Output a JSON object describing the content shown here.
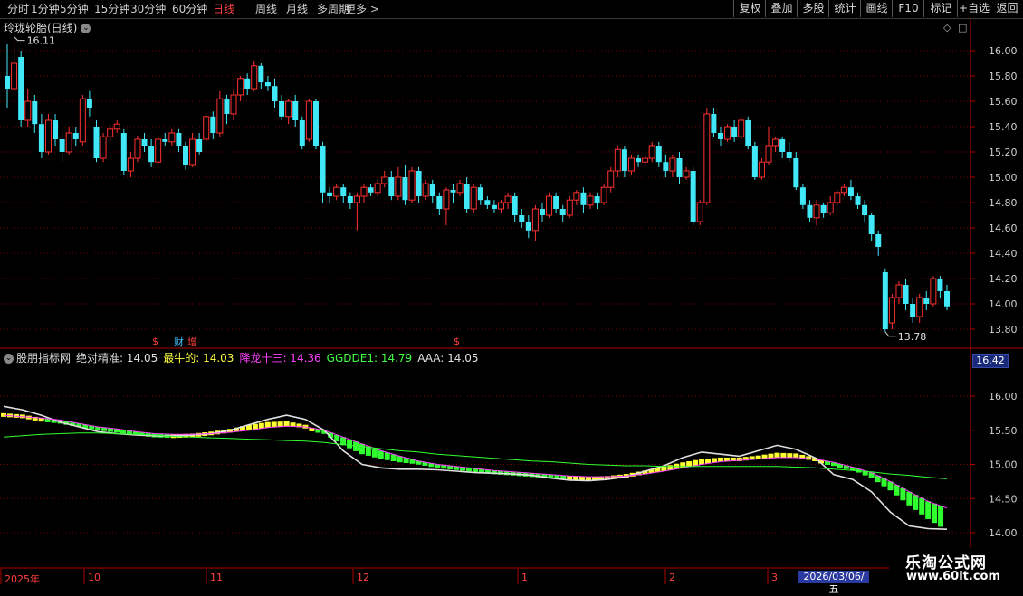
{
  "toolbar": {
    "periods": [
      "分时",
      "1分钟",
      "5分钟",
      "15分钟",
      "30分钟",
      "60分钟",
      "日线",
      "周线",
      "月线",
      "多周期",
      "更多 >"
    ],
    "active_period": "日线",
    "right_buttons": [
      "复权",
      "叠加",
      "多股",
      "统计",
      "画线",
      "F10",
      "标记",
      "+自选",
      "返回"
    ]
  },
  "chart_title": "玲珑轮胎(日线)",
  "price_high_label": "16.11",
  "price_low_label": "13.78",
  "markers": {
    "s1": "$",
    "cai": "财",
    "zeng": "增",
    "s2": "$"
  },
  "indicator": {
    "name": "股朋指标网",
    "items": [
      {
        "label": "绝对精准: 14.05",
        "color": "#e0e0e0"
      },
      {
        "label": "最牛的: 14.03",
        "color": "#ffff40"
      },
      {
        "label": "降龙十三: 14.36",
        "color": "#ff40ff"
      },
      {
        "label": "GGDDE1: 14.79",
        "color": "#40ff40"
      },
      {
        "label": "AAA: 14.05",
        "color": "#e0e0e0"
      }
    ],
    "current_box": "16.42"
  },
  "date_box": "2026/03/06/五",
  "x_labels": [
    "2025年",
    "10",
    "11",
    "12",
    "1",
    "2",
    "3"
  ],
  "watermark": {
    "line1": "乐淘公式网",
    "line2": "www.60lt.com"
  },
  "colors": {
    "up": "#ff3030",
    "down": "#40e8f8",
    "grid": "#7a0000",
    "indic_yellow": "#ffff30",
    "indic_green": "#30ff30"
  },
  "chart_data": {
    "type": "candlestick",
    "title": "玲珑轮胎(日线)",
    "price_axis": [
      16.0,
      15.8,
      15.6,
      15.4,
      15.2,
      15.0,
      14.8,
      14.6,
      14.4,
      14.2,
      14.0,
      13.8
    ],
    "indicator_axis": [
      16.0,
      15.5,
      15.0,
      14.5,
      14.0
    ],
    "candles": [
      [
        15.8,
        15.7,
        16.05,
        15.55
      ],
      [
        15.7,
        15.9,
        16.11,
        15.65
      ],
      [
        15.95,
        15.45,
        16.0,
        15.4
      ],
      [
        15.45,
        15.6,
        15.7,
        15.4
      ],
      [
        15.6,
        15.42,
        15.65,
        15.35
      ],
      [
        15.42,
        15.2,
        15.5,
        15.15
      ],
      [
        15.2,
        15.45,
        15.5,
        15.18
      ],
      [
        15.45,
        15.3,
        15.5,
        15.25
      ],
      [
        15.3,
        15.2,
        15.35,
        15.12
      ],
      [
        15.2,
        15.35,
        15.4,
        15.18
      ],
      [
        15.35,
        15.3,
        15.4,
        15.25
      ],
      [
        15.28,
        15.62,
        15.65,
        15.25
      ],
      [
        15.62,
        15.55,
        15.68,
        15.48
      ],
      [
        15.4,
        15.15,
        15.45,
        15.12
      ],
      [
        15.15,
        15.32,
        15.35,
        15.12
      ],
      [
        15.32,
        15.38,
        15.42,
        15.28
      ],
      [
        15.38,
        15.42,
        15.45,
        15.35
      ],
      [
        15.35,
        15.05,
        15.38,
        15.02
      ],
      [
        15.05,
        15.15,
        15.2,
        15.0
      ],
      [
        15.15,
        15.3,
        15.33,
        15.12
      ],
      [
        15.3,
        15.25,
        15.35,
        15.2
      ],
      [
        15.25,
        15.12,
        15.3,
        15.08
      ],
      [
        15.12,
        15.3,
        15.32,
        15.1
      ],
      [
        15.3,
        15.28,
        15.35,
        15.25
      ],
      [
        15.28,
        15.35,
        15.38,
        15.25
      ],
      [
        15.35,
        15.25,
        15.38,
        15.2
      ],
      [
        15.25,
        15.1,
        15.28,
        15.06
      ],
      [
        15.1,
        15.3,
        15.35,
        15.08
      ],
      [
        15.3,
        15.2,
        15.35,
        15.18
      ],
      [
        15.3,
        15.48,
        15.5,
        15.28
      ],
      [
        15.48,
        15.35,
        15.52,
        15.3
      ],
      [
        15.35,
        15.62,
        15.68,
        15.32
      ],
      [
        15.62,
        15.5,
        15.65,
        15.42
      ],
      [
        15.5,
        15.65,
        15.7,
        15.45
      ],
      [
        15.65,
        15.78,
        15.8,
        15.6
      ],
      [
        15.78,
        15.7,
        15.82,
        15.65
      ],
      [
        15.7,
        15.88,
        15.92,
        15.68
      ],
      [
        15.88,
        15.75,
        15.9,
        15.7
      ],
      [
        15.75,
        15.72,
        15.8,
        15.68
      ],
      [
        15.72,
        15.6,
        15.78,
        15.55
      ],
      [
        15.6,
        15.48,
        15.65,
        15.45
      ],
      [
        15.48,
        15.6,
        15.62,
        15.42
      ],
      [
        15.6,
        15.45,
        15.65,
        15.4
      ],
      [
        15.45,
        15.25,
        15.48,
        15.22
      ],
      [
        15.3,
        15.6,
        15.62,
        15.28
      ],
      [
        15.6,
        15.25,
        15.62,
        15.22
      ],
      [
        15.25,
        14.88,
        15.28,
        14.8
      ],
      [
        14.88,
        14.85,
        14.92,
        14.8
      ],
      [
        14.85,
        14.92,
        14.95,
        14.82
      ],
      [
        14.92,
        14.85,
        14.95,
        14.8
      ],
      [
        14.85,
        14.8,
        14.88,
        14.75
      ],
      [
        14.8,
        14.85,
        14.88,
        14.58
      ],
      [
        14.85,
        14.92,
        14.95,
        14.8
      ],
      [
        14.92,
        14.88,
        14.95,
        14.85
      ],
      [
        14.88,
        14.95,
        14.98,
        14.85
      ],
      [
        14.95,
        15.0,
        15.05,
        14.92
      ],
      [
        15.0,
        14.85,
        15.05,
        14.82
      ],
      [
        14.85,
        15.0,
        15.08,
        14.82
      ],
      [
        15.0,
        14.82,
        15.1,
        14.78
      ],
      [
        14.82,
        15.05,
        15.08,
        14.8
      ],
      [
        15.05,
        14.85,
        15.08,
        14.8
      ],
      [
        14.85,
        14.95,
        14.98,
        14.82
      ],
      [
        14.95,
        14.85,
        14.98,
        14.8
      ],
      [
        14.85,
        14.75,
        14.88,
        14.7
      ],
      [
        14.75,
        14.9,
        14.92,
        14.62
      ],
      [
        14.9,
        14.88,
        14.95,
        14.8
      ],
      [
        14.88,
        14.95,
        14.98,
        14.85
      ],
      [
        14.95,
        14.75,
        15.0,
        14.72
      ],
      [
        14.75,
        14.92,
        14.95,
        14.72
      ],
      [
        14.92,
        14.82,
        14.95,
        14.78
      ],
      [
        14.82,
        14.78,
        14.85,
        14.75
      ],
      [
        14.78,
        14.75,
        14.82,
        14.72
      ],
      [
        14.75,
        14.8,
        14.82,
        14.72
      ],
      [
        14.8,
        14.85,
        14.88,
        14.75
      ],
      [
        14.85,
        14.7,
        14.88,
        14.65
      ],
      [
        14.7,
        14.65,
        14.75,
        14.6
      ],
      [
        14.65,
        14.58,
        14.7,
        14.52
      ],
      [
        14.58,
        14.75,
        14.78,
        14.5
      ],
      [
        14.75,
        14.7,
        14.8,
        14.65
      ],
      [
        14.7,
        14.85,
        14.88,
        14.68
      ],
      [
        14.85,
        14.75,
        14.88,
        14.72
      ],
      [
        14.75,
        14.7,
        14.78,
        14.65
      ],
      [
        14.7,
        14.82,
        14.85,
        14.68
      ],
      [
        14.82,
        14.88,
        14.9,
        14.78
      ],
      [
        14.88,
        14.78,
        14.92,
        14.72
      ],
      [
        14.78,
        14.85,
        14.88,
        14.75
      ],
      [
        14.85,
        14.8,
        14.88,
        14.75
      ],
      [
        14.8,
        14.92,
        14.95,
        14.78
      ],
      [
        14.92,
        15.05,
        15.08,
        14.88
      ],
      [
        15.05,
        15.22,
        15.25,
        15.0
      ],
      [
        15.22,
        15.05,
        15.25,
        15.0
      ],
      [
        15.05,
        15.15,
        15.18,
        15.02
      ],
      [
        15.15,
        15.12,
        15.18,
        15.08
      ],
      [
        15.12,
        15.15,
        15.18,
        15.1
      ],
      [
        15.15,
        15.25,
        15.28,
        15.12
      ],
      [
        15.25,
        15.12,
        15.28,
        15.08
      ],
      [
        15.12,
        15.05,
        15.18,
        15.0
      ],
      [
        15.05,
        15.15,
        15.18,
        15.0
      ],
      [
        15.15,
        15.0,
        15.2,
        14.95
      ],
      [
        15.0,
        15.05,
        15.08,
        14.98
      ],
      [
        15.05,
        14.65,
        15.08,
        14.62
      ],
      [
        14.65,
        14.8,
        14.82,
        14.62
      ],
      [
        14.8,
        15.5,
        15.55,
        14.78
      ],
      [
        15.5,
        15.35,
        15.55,
        15.32
      ],
      [
        15.35,
        15.3,
        15.4,
        15.25
      ],
      [
        15.3,
        15.4,
        15.42,
        15.28
      ],
      [
        15.4,
        15.32,
        15.45,
        15.28
      ],
      [
        15.32,
        15.45,
        15.48,
        15.3
      ],
      [
        15.45,
        15.25,
        15.48,
        15.22
      ],
      [
        15.25,
        15.0,
        15.28,
        14.98
      ],
      [
        15.0,
        15.12,
        15.15,
        14.98
      ],
      [
        15.12,
        15.25,
        15.4,
        15.1
      ],
      [
        15.25,
        15.3,
        15.32,
        15.2
      ],
      [
        15.3,
        15.2,
        15.32,
        15.15
      ],
      [
        15.2,
        15.15,
        15.28,
        15.12
      ],
      [
        15.15,
        14.92,
        15.2,
        14.9
      ],
      [
        14.92,
        14.78,
        14.95,
        14.75
      ],
      [
        14.78,
        14.68,
        14.82,
        14.65
      ],
      [
        14.68,
        14.78,
        14.82,
        14.62
      ],
      [
        14.78,
        14.72,
        14.8,
        14.68
      ],
      [
        14.72,
        14.8,
        14.85,
        14.7
      ],
      [
        14.8,
        14.88,
        14.9,
        14.78
      ],
      [
        14.88,
        14.92,
        14.95,
        14.85
      ],
      [
        14.92,
        14.85,
        14.98,
        14.82
      ],
      [
        14.85,
        14.78,
        14.88,
        14.75
      ],
      [
        14.78,
        14.7,
        14.82,
        14.65
      ],
      [
        14.7,
        14.55,
        14.72,
        14.5
      ],
      [
        14.55,
        14.45,
        14.58,
        14.38
      ],
      [
        14.25,
        13.8,
        14.28,
        13.78
      ],
      [
        13.85,
        14.05,
        14.08,
        13.8
      ],
      [
        14.05,
        14.15,
        14.18,
        14.0
      ],
      [
        14.15,
        14.0,
        14.2,
        13.95
      ],
      [
        14.0,
        13.9,
        14.05,
        13.85
      ],
      [
        13.9,
        14.05,
        14.08,
        13.85
      ],
      [
        14.05,
        14.0,
        14.1,
        13.95
      ],
      [
        14.0,
        14.2,
        14.22,
        13.98
      ],
      [
        14.2,
        14.1,
        14.22,
        14.05
      ],
      [
        14.1,
        13.98,
        14.15,
        13.95
      ]
    ],
    "series": [
      {
        "name": "绝对精准",
        "values": [
          15.85,
          15.8,
          15.72,
          15.62,
          15.55,
          15.48,
          15.45,
          15.43,
          15.42,
          15.42,
          15.43,
          15.45,
          15.5,
          15.58,
          15.66,
          15.72,
          15.66,
          15.5,
          15.2,
          15.0,
          14.95,
          14.93,
          14.93,
          14.92,
          14.9,
          14.88,
          14.87,
          14.86,
          14.84,
          14.8,
          14.77,
          14.76,
          14.78,
          14.82,
          14.9,
          14.98,
          15.1,
          15.18,
          15.15,
          15.12,
          15.2,
          15.28,
          15.22,
          15.1,
          14.85,
          14.78,
          14.6,
          14.3,
          14.1,
          14.06,
          14.05
        ]
      },
      {
        "name": "最牛的",
        "values": [
          15.75,
          15.73,
          15.68,
          15.62,
          15.57,
          15.52,
          15.48,
          15.45,
          15.44,
          15.44,
          15.45,
          15.48,
          15.52,
          15.58,
          15.62,
          15.63,
          15.58,
          15.45,
          15.28,
          15.15,
          15.08,
          15.03,
          15.0,
          14.98,
          14.96,
          14.93,
          14.9,
          14.88,
          14.86,
          14.84,
          14.83,
          14.82,
          14.83,
          14.86,
          14.91,
          14.97,
          15.03,
          15.08,
          15.1,
          15.1,
          15.13,
          15.17,
          15.16,
          15.1,
          15.0,
          14.92,
          14.8,
          14.62,
          14.4,
          14.2,
          14.03
        ]
      },
      {
        "name": "降龙十三",
        "values": [
          15.72,
          15.7,
          15.68,
          15.65,
          15.6,
          15.55,
          15.52,
          15.48,
          15.45,
          15.44,
          15.44,
          15.45,
          15.47,
          15.5,
          15.54,
          15.56,
          15.55,
          15.5,
          15.4,
          15.3,
          15.2,
          15.12,
          15.05,
          15.0,
          14.97,
          14.94,
          14.91,
          14.89,
          14.87,
          14.85,
          14.83,
          14.82,
          14.82,
          14.83,
          14.86,
          14.9,
          14.95,
          15.0,
          15.04,
          15.06,
          15.08,
          15.1,
          15.1,
          15.08,
          15.03,
          14.96,
          14.88,
          14.75,
          14.6,
          14.46,
          14.36
        ]
      },
      {
        "name": "GGDDE1",
        "values": [
          15.4,
          15.42,
          15.44,
          15.45,
          15.46,
          15.46,
          15.45,
          15.44,
          15.43,
          15.41,
          15.4,
          15.39,
          15.38,
          15.37,
          15.36,
          15.35,
          15.34,
          15.32,
          15.29,
          15.26,
          15.23,
          15.2,
          15.18,
          15.15,
          15.13,
          15.11,
          15.09,
          15.07,
          15.05,
          15.04,
          15.02,
          15.0,
          14.99,
          14.98,
          14.98,
          14.97,
          14.97,
          14.97,
          14.97,
          14.97,
          14.97,
          14.97,
          14.96,
          14.95,
          14.93,
          14.91,
          14.89,
          14.86,
          14.84,
          14.81,
          14.79
        ]
      }
    ]
  }
}
